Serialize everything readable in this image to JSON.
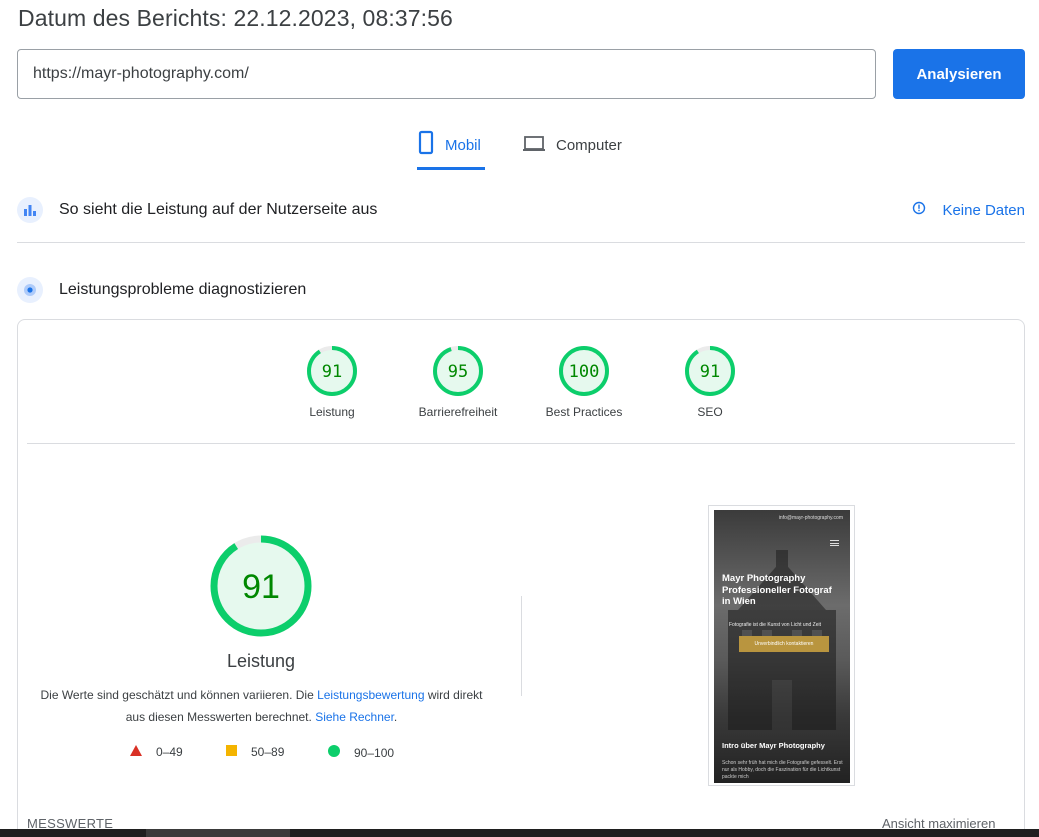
{
  "header": {
    "report_date": "Datum des Berichts: 22.12.2023, 08:37:56"
  },
  "search": {
    "url_value": "https://mayr-photography.com/",
    "analyze_label": "Analysieren"
  },
  "tabs": {
    "mobile": "Mobil",
    "desktop": "Computer",
    "active": "mobile"
  },
  "field_data": {
    "title": "So sieht die Leistung auf der Nutzerseite aus",
    "status": "Keine Daten"
  },
  "lab": {
    "title": "Leistungsprobleme diagnostizieren"
  },
  "scores": [
    {
      "value": "91",
      "label": "Leistung",
      "fraction": 0.91
    },
    {
      "value": "95",
      "label": "Barrierefreiheit",
      "fraction": 0.95
    },
    {
      "value": "100",
      "label": "Best Practices",
      "fraction": 1.0
    },
    {
      "value": "91",
      "label": "SEO",
      "fraction": 0.91
    }
  ],
  "performance": {
    "score": "91",
    "fraction": 0.91,
    "title": "Leistung",
    "desc_part1": "Die Werte sind geschätzt und können variieren. Die ",
    "link1": "Leistungsbewertung",
    "desc_part2": " wird direkt aus diesen Messwerten berechnet. ",
    "link2": "Siehe Rechner",
    "desc_part3": "."
  },
  "legend": [
    {
      "range": "0–49",
      "shape": "triangle",
      "color": "#d93025"
    },
    {
      "range": "50–89",
      "shape": "square",
      "color": "#f4b400"
    },
    {
      "range": "90–100",
      "shape": "circle",
      "color": "#0cce6b"
    }
  ],
  "preview": {
    "email": "info@mayr-photography.com",
    "hero_line1": "Mayr Photography",
    "hero_line2": "Professioneller Fotograf",
    "hero_line3": "in Wien",
    "subtitle": "Fotografie ist die Kunst von Licht und Zeit",
    "cta": "Unverbindlich kontaktieren",
    "intro": "Intro über Mayr Photography",
    "paragraph": "Schon sehr früh hat mich die Fotografie gefesselt. Erst nur als Hobby, doch die Faszination für die Lichtkunst packte mich"
  },
  "footer": {
    "metrics_label": "MESSWERTE",
    "expand_label": "Ansicht maximieren"
  },
  "colors": {
    "accent": "#1a73e8",
    "good": "#0cce6b",
    "good_text": "#008800",
    "good_bg": "#e6f9ee"
  }
}
